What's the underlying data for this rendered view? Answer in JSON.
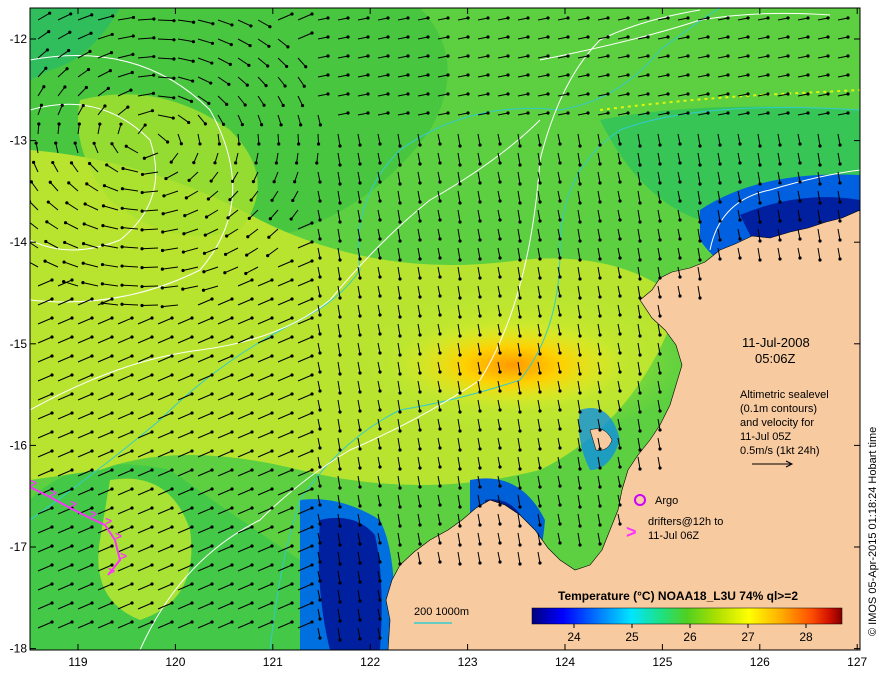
{
  "map": {
    "lon_ticks": [
      "119",
      "120",
      "121",
      "122",
      "123",
      "124",
      "125",
      "126",
      "127"
    ],
    "lat_ticks": [
      "-12",
      "-13",
      "-14",
      "-15",
      "-16",
      "-17",
      "-18"
    ],
    "land_color": "#f7caa0",
    "vector_color": "#000000",
    "ssh_contour_color": "#ffffff",
    "depth_contour_color": "#33cccc",
    "drifter_color": "#ff33ff",
    "argo_color": "#cc00ff"
  },
  "annotations": {
    "date": "11-Jul-2008",
    "time": "05:06Z",
    "altimetry_lines": [
      "Altimetric sealevel",
      "(0.1m contours)",
      "and velocity for",
      "11-Jul 05Z",
      "0.5m/s (1kt 24h)"
    ],
    "argo_label": "Argo",
    "drifter_lines": [
      "drifters@12h to",
      "11-Jul 06Z"
    ],
    "drifter_symbol": ">",
    "depth_legend": "200  1000m",
    "colorbar_title": "Temperature (°C) NOAA18_L3U 74% ql>=2",
    "colorbar_ticks": [
      "24",
      "25",
      "26",
      "27",
      "28"
    ],
    "colorbar_colors": [
      "#000080",
      "#0000ff",
      "#0080ff",
      "#00e5ff",
      "#20e080",
      "#40d020",
      "#a0e000",
      "#ffff00",
      "#ffb000",
      "#ff6000",
      "#e01000",
      "#800000"
    ],
    "credit": "© IMOS 05-Apr-2015 01:18:24 Hobart time"
  }
}
